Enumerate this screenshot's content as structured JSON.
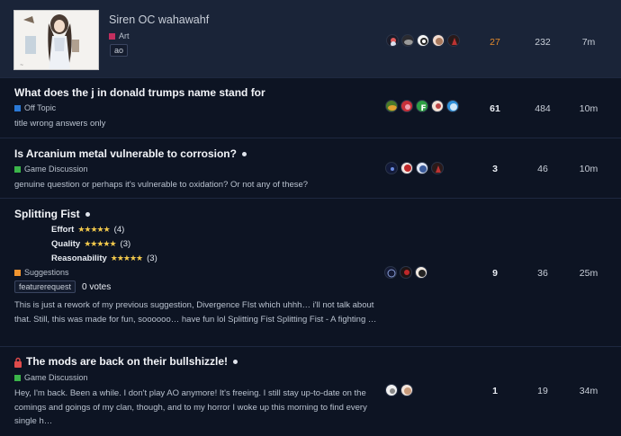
{
  "topics": [
    {
      "title": "Siren OC wahawahf",
      "category": "Art",
      "category_color": "#c22f5f",
      "tag": "ao",
      "replies": "27",
      "views": "232",
      "activity": "7m",
      "avatars": [
        "avatar-1",
        "avatar-2",
        "avatar-3",
        "avatar-4",
        "avatar-5"
      ]
    },
    {
      "title": "What does the j in donald trumps name stand for",
      "category": "Off Topic",
      "category_color": "#2a79d6",
      "excerpt": "title wrong answers only",
      "replies": "61",
      "views": "484",
      "activity": "10m",
      "avatars": [
        "avatar-1",
        "avatar-2",
        "avatar-3",
        "avatar-4",
        "avatar-5"
      ]
    },
    {
      "title": "Is Arcanium metal vulnerable to corrosion?",
      "category": "Game Discussion",
      "category_color": "#3bb54a",
      "excerpt": "genuine question or perhaps it's vulnerable to oxidation? Or not any of these?",
      "replies": "3",
      "views": "46",
      "activity": "10m",
      "avatars": [
        "avatar-1",
        "avatar-2",
        "avatar-3",
        "avatar-4"
      ]
    },
    {
      "title": "Splitting Fist",
      "ratings": [
        {
          "label": "Effort",
          "stars": "★★★★★",
          "count": "(4)"
        },
        {
          "label": "Quality",
          "stars": "★★★★★",
          "count": "(3)"
        },
        {
          "label": "Reasonability",
          "stars": "★★★★★",
          "count": "(3)"
        }
      ],
      "category": "Suggestions",
      "category_color": "#f0942f",
      "tag": "featurerequest",
      "votes": "0 votes",
      "excerpt": "This is just a rework of my previous suggestion, Divergence FIst which uhhh… i'll not talk about that. Still, this was made for fun, soooooo… have fun lol Splitting Fist Splitting Fist - A fighting …",
      "replies": "9",
      "views": "36",
      "activity": "25m",
      "avatars": [
        "avatar-1",
        "avatar-2",
        "avatar-3"
      ]
    },
    {
      "title": "The mods are back on their bullshizzle!",
      "category": "Game Discussion",
      "category_color": "#3bb54a",
      "excerpt": "Hey, I'm back. Been a while. I don't play AO anymore! It's freeing. I still stay up-to-date on the comings and goings of my clan, though, and to my horror I woke up this morning to find every single h…",
      "replies": "1",
      "views": "19",
      "activity": "34m",
      "avatars": [
        "avatar-1",
        "avatar-2"
      ]
    }
  ]
}
